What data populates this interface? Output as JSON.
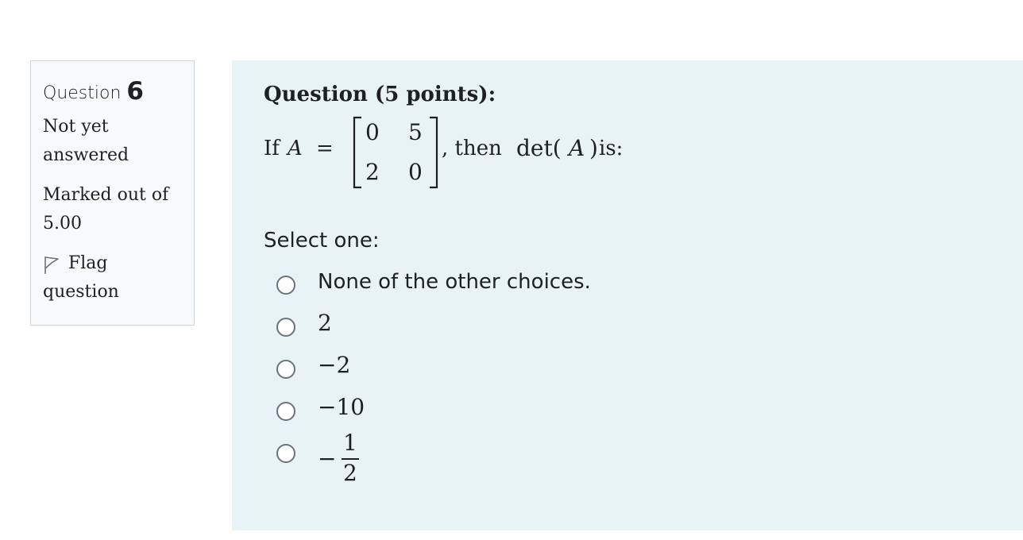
{
  "info": {
    "question_word": "Question",
    "question_number": "6",
    "status": [
      "Not yet",
      "answered"
    ],
    "marks": [
      "Marked out of",
      "5.00"
    ],
    "flag": [
      "Flag",
      "question"
    ]
  },
  "question": {
    "title": "Question (5 points):",
    "stem_if": "If",
    "stem_var": "A",
    "stem_eq": "=",
    "matrix": [
      [
        "0",
        "5"
      ],
      [
        "2",
        "0"
      ]
    ],
    "stem_then": ", then",
    "stem_det": "det(",
    "stem_det_var": "A",
    "stem_det_close": ")",
    "stem_is": " is:",
    "prompt": "Select one:"
  },
  "options": [
    {
      "label": "None of the other choices."
    },
    {
      "label": "2"
    },
    {
      "label": "−2"
    },
    {
      "label": "−10"
    },
    {
      "minus": "−",
      "numerator": "1",
      "denominator": "2"
    }
  ],
  "colors": {
    "panel_bg": "#e7f3f5",
    "info_bg": "#f8f9fa",
    "border": "#cfd4d9",
    "text": "#1d2125"
  },
  "icons": {
    "flag": "flag-icon"
  }
}
